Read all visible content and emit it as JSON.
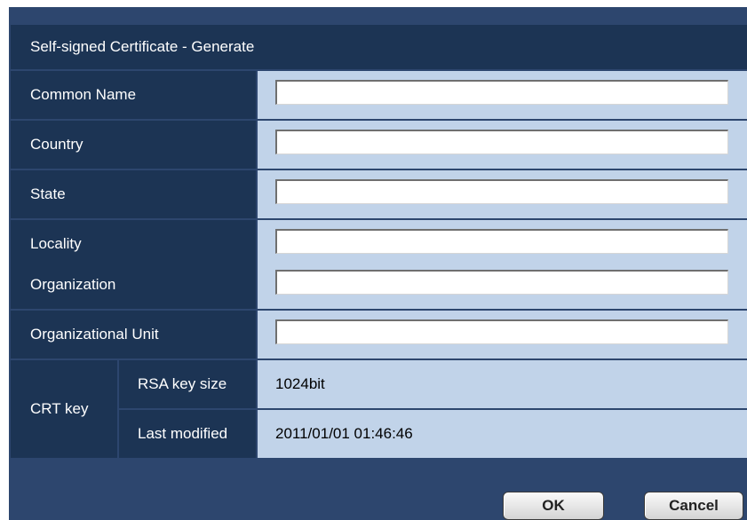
{
  "dialog": {
    "title": "Self-signed Certificate - Generate"
  },
  "fields": [
    {
      "label": "Common Name",
      "value": ""
    },
    {
      "label": "Country",
      "value": ""
    },
    {
      "label": "State",
      "value": ""
    },
    {
      "label": "Locality",
      "value": ""
    },
    {
      "label": "Organization",
      "value": ""
    },
    {
      "label": "Organizational Unit",
      "value": ""
    }
  ],
  "crt_key": {
    "label": "CRT key",
    "rsa_key_size_label": "RSA key size",
    "rsa_key_size_value": "1024bit",
    "last_modified_label": "Last modified",
    "last_modified_value": "2011/01/01 01:46:46"
  },
  "buttons": {
    "ok_label": "OK",
    "cancel_label": "Cancel"
  },
  "colors": {
    "dialog_bg": "#2d466e",
    "label_bg": "#1c3454",
    "value_bg": "#c1d3e9"
  }
}
